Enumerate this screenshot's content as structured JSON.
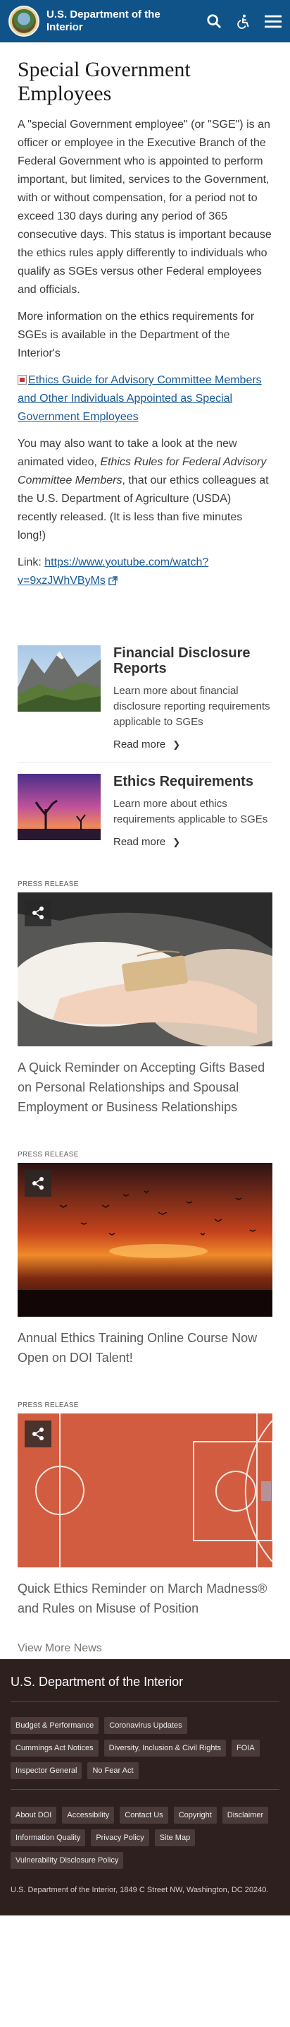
{
  "header": {
    "brand": "U.S. Department of the Interior",
    "icons": [
      "search-icon",
      "accessibility-icon",
      "menu-icon"
    ]
  },
  "main": {
    "title": "Special Government Employees",
    "paragraph1": "A \"special Government employee\" (or \"SGE\") is an officer or employee in the Executive Branch of the Federal Government who is appointed to perform important, but limited, services to the Government, with or without compensation, for a period not to exceed 130 days during any period of 365 consecutive days. This status is important because the ethics rules apply differently to individuals who qualify as SGEs versus other Federal employees and officials.",
    "paragraph2": "More information on the ethics requirements for SGEs is available in the Department of the Interior's",
    "guide_link": "Ethics Guide for Advisory Committee Members and Other Individuals Appointed as Special Government Employees",
    "paragraph3_pre": "You may also want to take a look at the new animated video, ",
    "paragraph3_em": "Ethics Rules for Federal Advisory Committee Members",
    "paragraph3_post": ", that our ethics colleagues at the U.S. Department of Agriculture (USDA) recently released.  (It is less than five minutes long!)",
    "link_label": "Link: ",
    "video_link": "https://www.youtube.com/watch?v=9xzJWhVByMs"
  },
  "cards": [
    {
      "title": "Financial Disclosure Reports",
      "desc": "Learn more about financial disclosure reporting requirements applicable to SGEs",
      "read_more": "Read more"
    },
    {
      "title": "Ethics Requirements",
      "desc": "Learn more about ethics requirements applicable to SGEs",
      "read_more": "Read more"
    }
  ],
  "press": [
    {
      "label": "PRESS RELEASE",
      "title": "A Quick Reminder on Accepting Gifts Based on Personal Relationships and Spousal Employment or Business Relationships"
    },
    {
      "label": "PRESS RELEASE",
      "title": "Annual Ethics Training Online Course Now Open on DOI Talent!"
    },
    {
      "label": "PRESS RELEASE",
      "title": "Quick Ethics Reminder on March Madness® and Rules on Misuse of Position"
    }
  ],
  "view_more": "View More News",
  "footer": {
    "title": "U.S. Department of the Interior",
    "links_group1": [
      "Budget & Performance",
      "Coronavirus Updates",
      "Cummings Act Notices",
      "Diversity, Inclusion & Civil Rights",
      "FOIA",
      "Inspector General",
      "No Fear Act"
    ],
    "links_group2": [
      "About DOI",
      "Accessibility",
      "Contact Us",
      "Copyright",
      "Disclaimer",
      "Information Quality",
      "Privacy Policy",
      "Site Map",
      "Vulnerability Disclosure Policy"
    ],
    "address": "U.S. Department of the Interior, 1849 C Street NW, Washington, DC 20240."
  },
  "colors": {
    "header_bg": "#0f5389",
    "footer_bg": "#2d201f",
    "link": "#1a5a96"
  }
}
